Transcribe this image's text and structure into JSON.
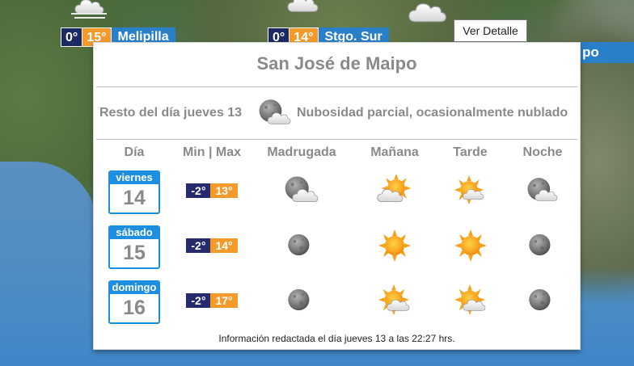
{
  "map": {
    "stations": [
      {
        "min": "0°",
        "max": "15°",
        "name": "Melipilla"
      },
      {
        "min": "0°",
        "max": "14°",
        "name": "Stgo. Sur"
      }
    ],
    "edge_label": "po"
  },
  "tooltip": {
    "text": "Ver Detalle"
  },
  "panel": {
    "title": "San José de Maipo",
    "today": {
      "label": "Resto del día jueves 13",
      "icon": "partly-cloudy-night-icon",
      "description": "Nubosidad parcial, ocasionalmente nublado"
    },
    "headers": {
      "day": "Día",
      "minmax": "Min | Max",
      "madrugada": "Madrugada",
      "manana": "Mañana",
      "tarde": "Tarde",
      "noche": "Noche"
    },
    "days": [
      {
        "weekday": "viernes",
        "day": "14",
        "min": "-2°",
        "max": "13°",
        "madrugada": "partly-cloudy-night-icon",
        "manana": "partly-cloudy-day-icon",
        "tarde": "partly-cloudy-day-icon",
        "noche": "partly-cloudy-night-icon"
      },
      {
        "weekday": "sábado",
        "day": "15",
        "min": "-2°",
        "max": "14°",
        "madrugada": "clear-night-icon",
        "manana": "sunny-icon",
        "tarde": "sunny-icon",
        "noche": "clear-night-icon"
      },
      {
        "weekday": "domingo",
        "day": "16",
        "min": "-2°",
        "max": "17°",
        "madrugada": "clear-night-icon",
        "manana": "partly-cloudy-day-icon",
        "tarde": "partly-cloudy-day-icon",
        "noche": "clear-night-icon"
      }
    ],
    "footer": "Información redactada el día jueves 13 a las 22:27 hrs."
  },
  "colors": {
    "min_bg": "#262b6b",
    "max_bg": "#f39a2b",
    "calendar_blue": "#1e8ee0",
    "header_gray": "#8a8a8a"
  }
}
